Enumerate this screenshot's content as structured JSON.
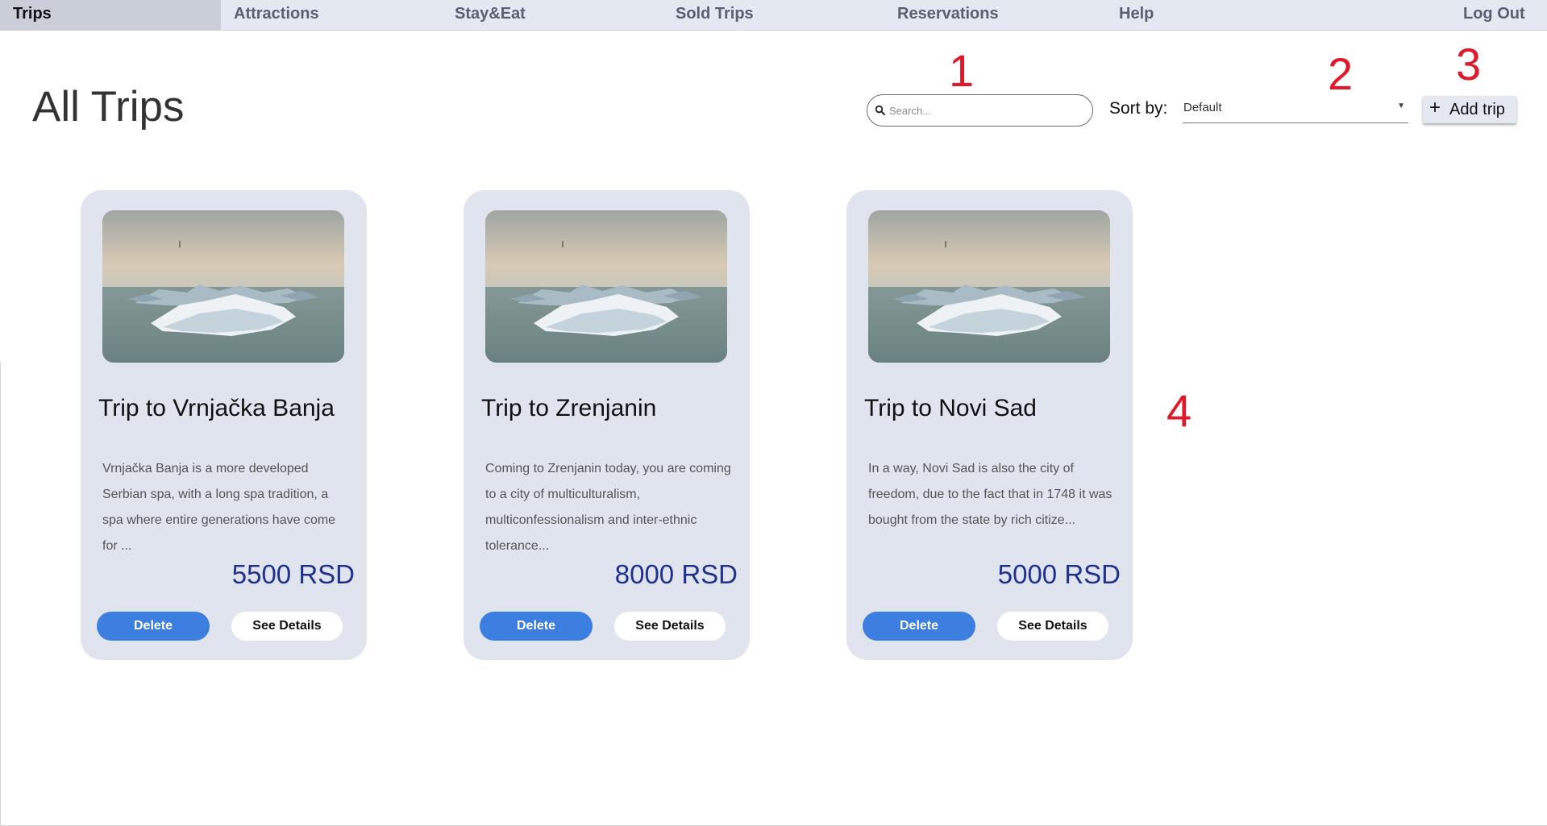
{
  "nav": {
    "items": [
      {
        "label": "Trips",
        "active": true
      },
      {
        "label": "Attractions"
      },
      {
        "label": "Stay&Eat"
      },
      {
        "label": "Sold Trips"
      },
      {
        "label": "Reservations"
      },
      {
        "label": "Help"
      }
    ],
    "logout": "Log Out"
  },
  "page": {
    "title": "All Trips"
  },
  "search": {
    "placeholder": "Search...",
    "value": ""
  },
  "sort": {
    "label": "Sort by:",
    "selected": "Default"
  },
  "add_button": {
    "label": "Add trip"
  },
  "annotations": [
    "1",
    "2",
    "3",
    "4"
  ],
  "trips": [
    {
      "title": "Trip to Vrnjačka Banja",
      "description": "Vrnjačka Banja is a more developed Serbian spa, with a long spa tradition, a spa where entire generations have come for ...",
      "price": "5500 RSD",
      "delete_label": "Delete",
      "details_label": "See Details"
    },
    {
      "title": "Trip to Zrenjanin",
      "description": "Coming to Zrenjanin today, you are coming to a city of multiculturalism, multiconfessionalism and inter-ethnic tolerance...",
      "price": "8000 RSD",
      "delete_label": "Delete",
      "details_label": "See Details"
    },
    {
      "title": "Trip to Novi Sad",
      "description": "In a way, Novi Sad is also the city of freedom, due to the fact that in 1748 it was bought from the state by rich citize...",
      "price": "5000 RSD",
      "delete_label": "Delete",
      "details_label": "See Details"
    }
  ],
  "colors": {
    "nav_bg": "#e3e8f1",
    "card_bg": "#dfe4ee",
    "price": "#1f318a",
    "delete_button": "#3d7fe0",
    "annotation": "#e0192a"
  }
}
